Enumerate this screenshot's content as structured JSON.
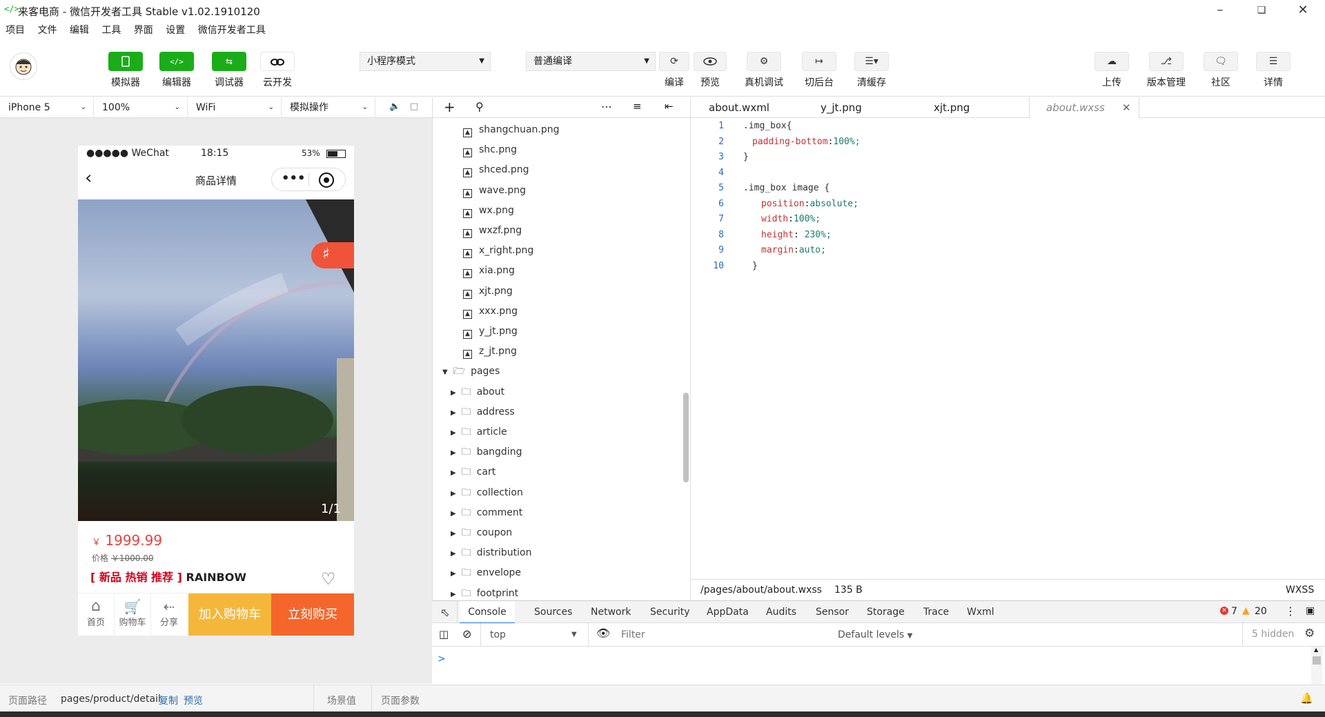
{
  "window": {
    "title": "来客电商 - 微信开发者工具 Stable v1.02.1910120",
    "logo": "</>"
  },
  "menu": [
    "项目",
    "文件",
    "编辑",
    "工具",
    "界面",
    "设置",
    "微信开发者工具"
  ],
  "toolbar": {
    "left": [
      {
        "label": "模拟器",
        "icon": "phone-icon"
      },
      {
        "label": "编辑器",
        "icon": "code-icon"
      },
      {
        "label": "调试器",
        "icon": "debug-icon"
      },
      {
        "label": "云开发",
        "icon": "cloud-icon"
      }
    ],
    "mode_select": "小程序模式",
    "compile_select": "普通编译",
    "middle": [
      {
        "label": "编译",
        "icon": "refresh-icon"
      },
      {
        "label": "预览",
        "icon": "eye-icon"
      },
      {
        "label": "真机调试",
        "icon": "bug-icon"
      },
      {
        "label": "切后台",
        "icon": "switch-icon"
      },
      {
        "label": "清缓存",
        "icon": "layers-icon"
      }
    ],
    "right": [
      {
        "label": "上传",
        "icon": "upload-icon"
      },
      {
        "label": "版本管理",
        "icon": "branch-icon"
      },
      {
        "label": "社区",
        "icon": "chat-icon"
      },
      {
        "label": "详情",
        "icon": "menu-icon"
      }
    ]
  },
  "simbar": {
    "device": "iPhone 5",
    "zoom": "100%",
    "network": "WiFi",
    "operation": "模拟操作"
  },
  "phone": {
    "signal": "●●●●● WeChat",
    "time": "18:15",
    "battery": "53%",
    "nav_title": "商品详情",
    "pager": "1/1",
    "price_symbol": "￥",
    "price": "1999.99",
    "old_price_label": "价格",
    "old_price": "￥1000.00",
    "tags": "[ 新品 热销 推荐 ]",
    "product_name": "RAINBOW",
    "bottom": {
      "home": "首页",
      "cart": "购物车",
      "share": "分享",
      "add_cart": "加入购物车",
      "buy_now": "立刻购买"
    }
  },
  "sim_footer": {
    "path_label": "页面路径",
    "path": "pages/product/detail",
    "copy": "复制",
    "preview": "预览",
    "scene": "场景值",
    "params": "页面参数"
  },
  "files": [
    {
      "name": "shangchuan.png",
      "type": "image",
      "depth": 2
    },
    {
      "name": "shc.png",
      "type": "image",
      "depth": 2
    },
    {
      "name": "shced.png",
      "type": "image",
      "depth": 2
    },
    {
      "name": "wave.png",
      "type": "image",
      "depth": 2
    },
    {
      "name": "wx.png",
      "type": "image",
      "depth": 2
    },
    {
      "name": "wxzf.png",
      "type": "image",
      "depth": 2
    },
    {
      "name": "x_right.png",
      "type": "image",
      "depth": 2
    },
    {
      "name": "xia.png",
      "type": "image",
      "depth": 2
    },
    {
      "name": "xjt.png",
      "type": "image",
      "depth": 2
    },
    {
      "name": "xxx.png",
      "type": "image",
      "depth": 2
    },
    {
      "name": "y_jt.png",
      "type": "image",
      "depth": 2
    },
    {
      "name": "z_jt.png",
      "type": "image",
      "depth": 2
    },
    {
      "name": "pages",
      "type": "folder-open",
      "depth": 0
    },
    {
      "name": "about",
      "type": "folder",
      "depth": 1
    },
    {
      "name": "address",
      "type": "folder",
      "depth": 1
    },
    {
      "name": "article",
      "type": "folder",
      "depth": 1
    },
    {
      "name": "bangding",
      "type": "folder",
      "depth": 1
    },
    {
      "name": "cart",
      "type": "folder",
      "depth": 1
    },
    {
      "name": "collection",
      "type": "folder",
      "depth": 1
    },
    {
      "name": "comment",
      "type": "folder",
      "depth": 1
    },
    {
      "name": "coupon",
      "type": "folder",
      "depth": 1
    },
    {
      "name": "distribution",
      "type": "folder",
      "depth": 1
    },
    {
      "name": "envelope",
      "type": "folder",
      "depth": 1
    },
    {
      "name": "footprint",
      "type": "folder",
      "depth": 1
    }
  ],
  "editor_tabs": [
    {
      "label": "about.wxml",
      "active": false
    },
    {
      "label": "y_jt.png",
      "active": false
    },
    {
      "label": "xjt.png",
      "active": false
    },
    {
      "label": "about.wxss",
      "active": true
    }
  ],
  "code_lines": [
    {
      "n": "1",
      "text": ".img_box{",
      "indent": 0
    },
    {
      "n": "2",
      "text": "padding-bottom:100%;",
      "indent": 1
    },
    {
      "n": "3",
      "text": "}",
      "indent": 0
    },
    {
      "n": "4",
      "text": "",
      "indent": 0
    },
    {
      "n": "5",
      "text": ".img_box image {",
      "indent": 0
    },
    {
      "n": "6",
      "text": "position:absolute;",
      "indent": 2
    },
    {
      "n": "7",
      "text": "width:100%;",
      "indent": 2
    },
    {
      "n": "8",
      "text": "height: 230%;",
      "indent": 2
    },
    {
      "n": "9",
      "text": "margin:auto;",
      "indent": 2
    },
    {
      "n": "10",
      "text": "}",
      "indent": 1
    }
  ],
  "status": {
    "path": "/pages/about/about.wxss",
    "size": "135 B",
    "lang": "WXSS"
  },
  "devtools": {
    "tabs": [
      "Console",
      "Sources",
      "Network",
      "Security",
      "AppData",
      "Audits",
      "Sensor",
      "Storage",
      "Trace",
      "Wxml"
    ],
    "errors": "7",
    "warnings": "20",
    "context": "top",
    "filter_placeholder": "Filter",
    "levels": "Default levels",
    "hidden": "5 hidden",
    "prompt": ">"
  },
  "colors": {
    "green": "#1aad19",
    "price": "#e64340",
    "add_cart": "#f5b73b",
    "buy_now": "#f4662b"
  }
}
